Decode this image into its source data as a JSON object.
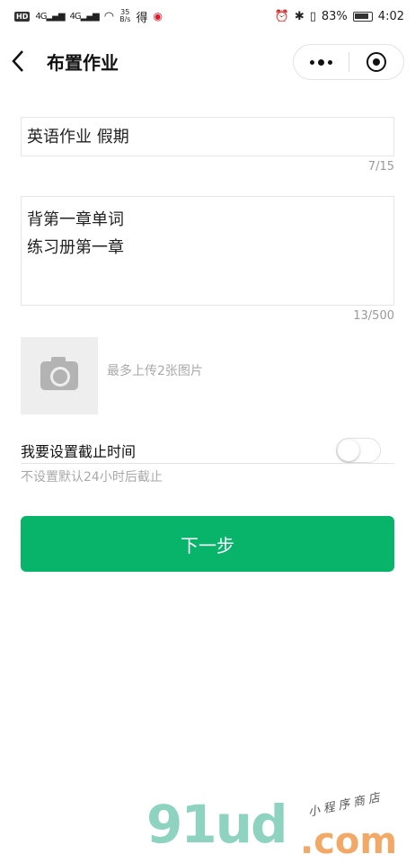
{
  "status_bar": {
    "hd": "HD",
    "signal_1": "4G",
    "signal_2": "4G",
    "speed_value": "35",
    "speed_unit": "B/s",
    "app_glyph": "得",
    "battery_percent": "83%",
    "time": "4:02",
    "icons": [
      "alarm-icon",
      "bluetooth-icon",
      "vibrate-icon",
      "battery-icon",
      "wifi-icon",
      "weibo-icon"
    ]
  },
  "navbar": {
    "title": "布置作业",
    "back_icon": "chevron-left-icon",
    "capsule_icons": [
      "more-dots-icon",
      "close-target-icon"
    ]
  },
  "form": {
    "title_value": "英语作业 假期",
    "title_counter": "7/15",
    "content_value": "背第一章单词\n练习册第一章",
    "content_counter": "13/500",
    "upload_hint": "最多上传2张图片",
    "upload_icon": "camera-icon",
    "deadline_label": "我要设置截止时间",
    "deadline_switch_on": false,
    "deadline_note": "不设置默认24小时后截止",
    "next_button": "下一步"
  },
  "watermark": {
    "brand": "91ud",
    "suffix": ".com",
    "tagline": "小程序商店"
  },
  "colors": {
    "primary_button": "#07b46a",
    "placeholder_gray": "#a9a9a9",
    "border_gray": "#e5e5e5"
  }
}
